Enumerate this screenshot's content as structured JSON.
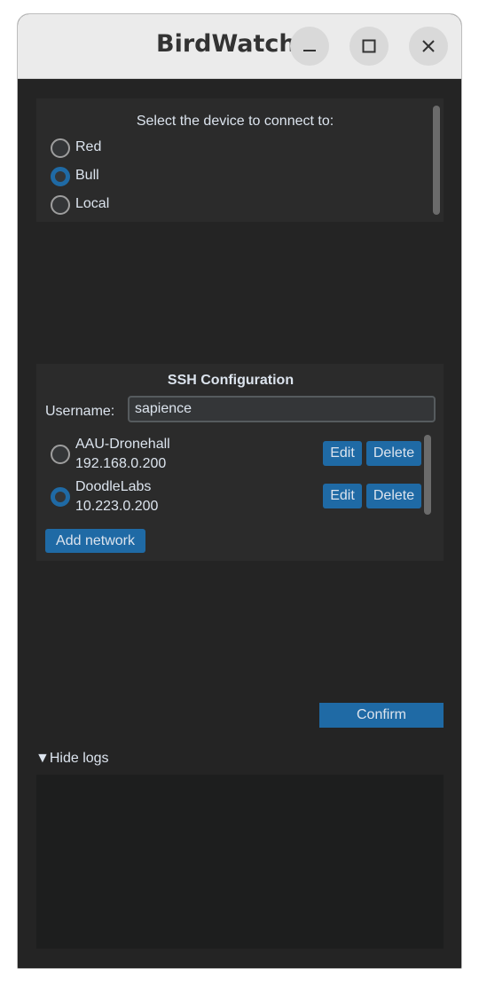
{
  "window": {
    "title": "BirdWatch"
  },
  "device": {
    "heading": "Select the device to connect to:",
    "options": [
      {
        "label": "Red",
        "selected": false
      },
      {
        "label": "Bull",
        "selected": true
      },
      {
        "label": "Local",
        "selected": false
      }
    ]
  },
  "ssh": {
    "heading": "SSH Configuration",
    "username_label": "Username:",
    "username_value": "sapience",
    "networks": [
      {
        "name": "AAU-Dronehall",
        "ip": "192.168.0.200",
        "selected": false,
        "edit_label": "Edit",
        "delete_label": "Delete"
      },
      {
        "name": "DoodleLabs",
        "ip": "10.223.0.200",
        "selected": true,
        "edit_label": "Edit",
        "delete_label": "Delete"
      }
    ],
    "add_network_label": "Add network"
  },
  "confirm_label": "Confirm",
  "logs": {
    "toggle_label": "▼Hide logs",
    "content": ""
  },
  "colors": {
    "accent": "#1f6aa5",
    "panel": "#2b2b2b",
    "background": "#242424",
    "text": "#dce4ee"
  }
}
